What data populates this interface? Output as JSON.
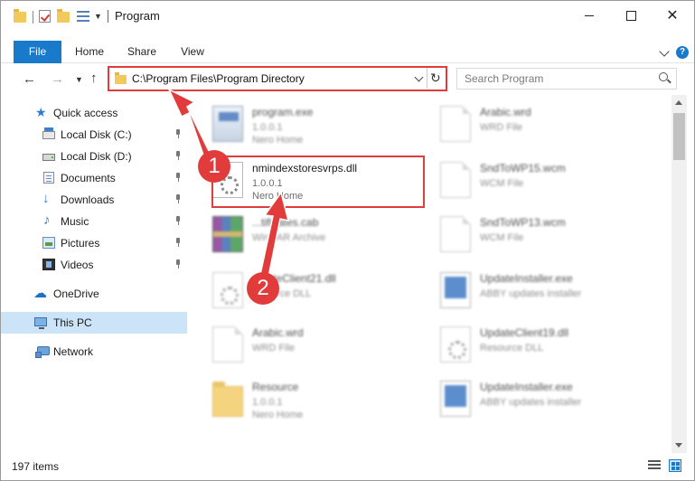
{
  "window": {
    "title": "Program"
  },
  "ribbon": {
    "tabs": [
      {
        "label": "File"
      },
      {
        "label": "Home"
      },
      {
        "label": "Share"
      },
      {
        "label": "View"
      }
    ]
  },
  "address": {
    "path": "C:\\Program Files\\Program Directory"
  },
  "search": {
    "placeholder": "Search Program"
  },
  "sidebar": {
    "quick_access": "Quick access",
    "items": [
      {
        "label": "Local Disk (C:)"
      },
      {
        "label": "Local Disk (D:)"
      },
      {
        "label": "Documents"
      },
      {
        "label": "Downloads"
      },
      {
        "label": "Music"
      },
      {
        "label": "Pictures"
      },
      {
        "label": "Videos"
      }
    ],
    "onedrive": "OneDrive",
    "this_pc": "This PC",
    "network": "Network"
  },
  "files": [
    {
      "name": "program.exe",
      "line1": "1.0.0.1",
      "line2": "Nero Home"
    },
    {
      "name": "Arabic.wrd",
      "line1": "WRD File",
      "line2": ""
    },
    {
      "name": "nmindexstoresvrps.dll",
      "line1": "1.0.0.1",
      "line2": "Nero Home"
    },
    {
      "name": "SndToWP15.wcm",
      "line1": "WCM File",
      "line2": ""
    },
    {
      "name": "...tificates.cab",
      "line1": "WinRAR Archive",
      "line2": ""
    },
    {
      "name": "SndToWP13.wcm",
      "line1": "WCM File",
      "line2": ""
    },
    {
      "name": "...dateClient21.dll",
      "line1": "...source DLL",
      "line2": ""
    },
    {
      "name": "UpdateInstaller.exe",
      "line1": "ABBY updates installer",
      "line2": ""
    },
    {
      "name": "Arabic.wrd",
      "line1": "WRD File",
      "line2": ""
    },
    {
      "name": "UpdateClient19.dll",
      "line1": "Resource DLL",
      "line2": ""
    },
    {
      "name": "Resource",
      "line1": "1.0.0.1",
      "line2": "Nero Home"
    },
    {
      "name": "UpdateInstaller.exe",
      "line1": "ABBY updates installer",
      "line2": ""
    }
  ],
  "status": {
    "item_count": "197 items"
  },
  "annotations": {
    "step1": "1",
    "step2": "2",
    "color": "#e23b3b"
  },
  "colors": {
    "accent": "#1979ca",
    "selected": "#cce4f7"
  }
}
